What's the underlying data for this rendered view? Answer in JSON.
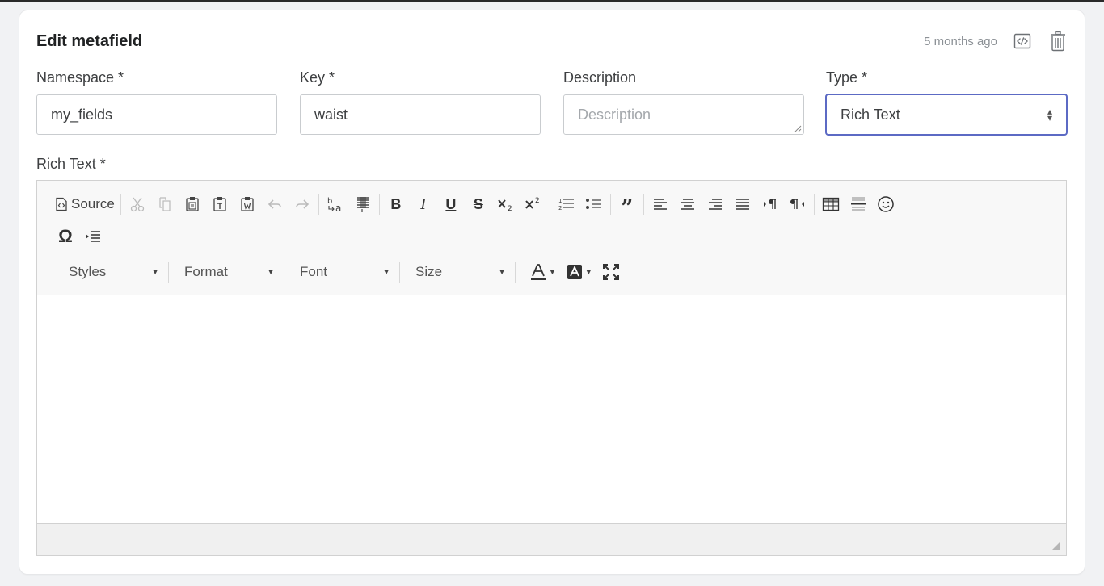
{
  "card": {
    "title": "Edit metafield",
    "timestamp": "5 months ago"
  },
  "icons": {
    "code": "code-icon",
    "delete": "trash-icon"
  },
  "fields": {
    "namespace": {
      "label": "Namespace *",
      "value": "my_fields"
    },
    "key": {
      "label": "Key *",
      "value": "waist"
    },
    "description": {
      "label": "Description",
      "value": "",
      "placeholder": "Description"
    },
    "type": {
      "label": "Type *",
      "value": "Rich Text"
    }
  },
  "rich_text": {
    "label": "Rich Text *",
    "toolbar": {
      "source_label": "Source",
      "bold": "B",
      "italic": "I",
      "underline": "U",
      "strike": "S",
      "omega": "Ω",
      "styles_label": "Styles",
      "format_label": "Format",
      "font_label": "Font",
      "size_label": "Size"
    },
    "content": ""
  },
  "colors": {
    "accent": "#5c6ac4",
    "background": "#f1f2f4"
  }
}
